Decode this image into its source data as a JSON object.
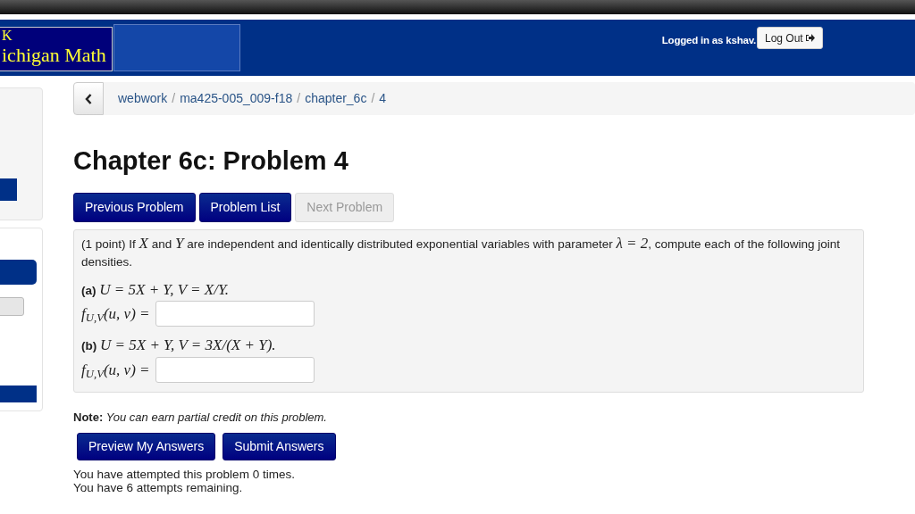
{
  "header": {
    "logo_lines": [
      "K",
      "ichigan Math"
    ],
    "login_text": "Logged in as kshav.",
    "logout_button": "Log Out"
  },
  "breadcrumb": {
    "separator": "/",
    "items": [
      {
        "label": "webwork"
      },
      {
        "label": "ma425-005_009-f18"
      },
      {
        "label": "chapter_6c"
      },
      {
        "label": "4"
      }
    ]
  },
  "title": "Chapter 6c: Problem 4",
  "nav_buttons": [
    {
      "label": "Previous Problem",
      "disabled": false
    },
    {
      "label": "Problem List",
      "disabled": false
    },
    {
      "label": "Next Problem",
      "disabled": true
    }
  ],
  "problem": {
    "intro": [
      {
        "kind": "text",
        "text": "(1 point) If "
      },
      {
        "kind": "math",
        "text": "X"
      },
      {
        "kind": "text",
        "text": " and "
      },
      {
        "kind": "math",
        "text": "Y"
      },
      {
        "kind": "text",
        "text": " are independent and identically distributed exponential variables with parameter "
      },
      {
        "kind": "math",
        "text": "λ = 2"
      },
      {
        "kind": "text",
        "text": ", compute each of the following joint densities."
      }
    ],
    "parts": [
      {
        "label": "(a)",
        "statement": "U = 5X + Y, V = X/Y.",
        "answer_label": "f$_{U,V}$(u, v) ="
      },
      {
        "label": "(b)",
        "statement": "U = 5X + Y, V = 3X/(X + Y).",
        "answer_label": "f$_{U,V}$(u, v) ="
      }
    ]
  },
  "note": "**Note:** *You can earn partial credit on this problem.*",
  "submit_buttons": [
    "Preview My Answers",
    "Submit Answers"
  ],
  "attempt_lines": [
    "You have attempted this problem 0 times.",
    "You have 6 attempts remaining."
  ]
}
